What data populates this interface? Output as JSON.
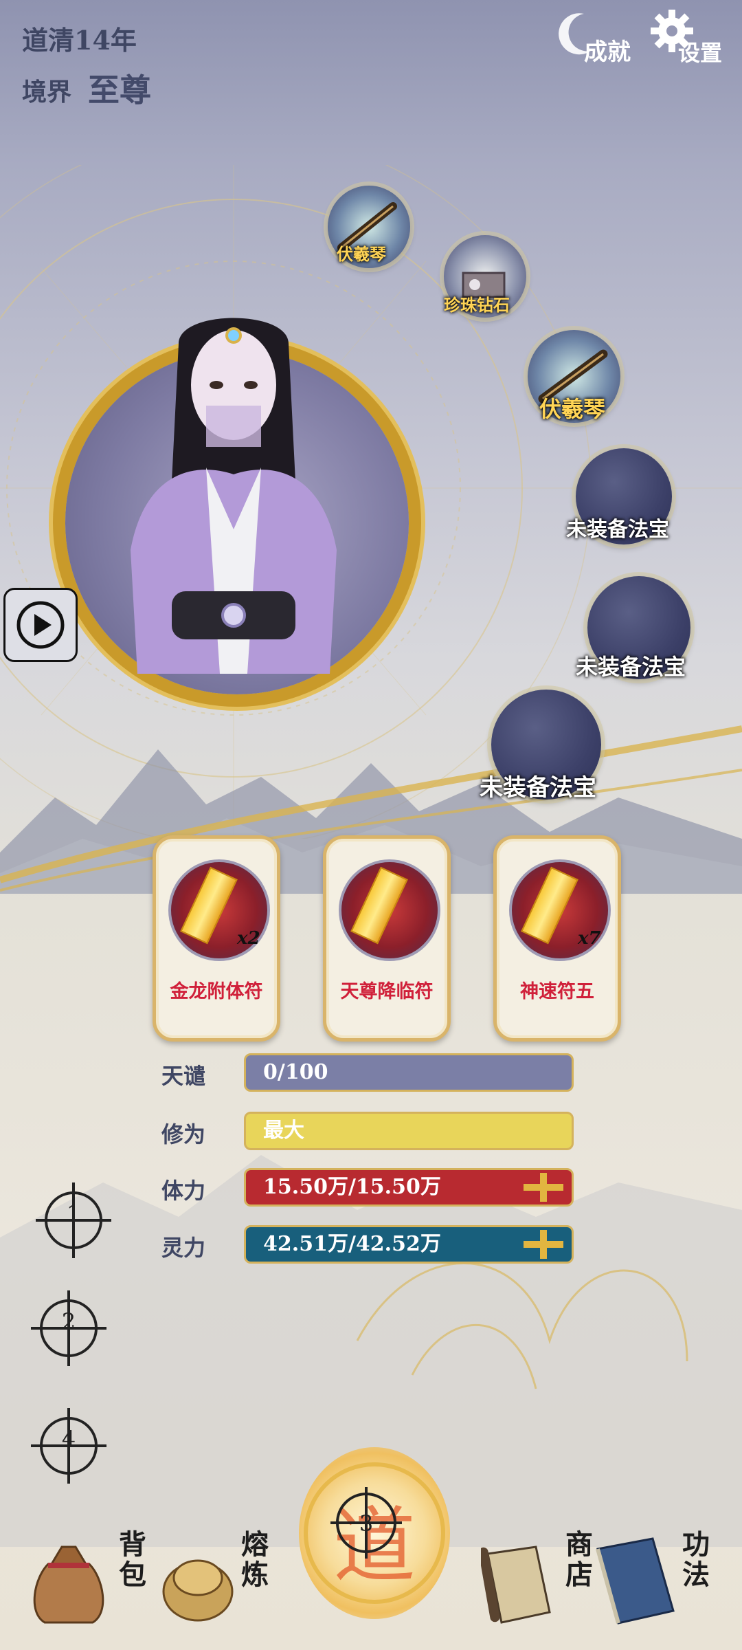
{
  "header": {
    "dao_label": "道清14年",
    "realm_label": "境界",
    "realm_value": "至尊",
    "achievement_label": "成就",
    "settings_label": "设置"
  },
  "equipment_slots": [
    {
      "label": "伏羲琴"
    },
    {
      "label": "珍珠钻石"
    },
    {
      "label": "伏羲琴"
    },
    {
      "label": "未装备法宝"
    },
    {
      "label": "未装备法宝"
    },
    {
      "label": "未装备法宝"
    }
  ],
  "talismans": [
    {
      "name": "金龙附体符",
      "count": "x2"
    },
    {
      "name": "天尊降临符",
      "count": ""
    },
    {
      "name": "神速符五",
      "count": "x7"
    }
  ],
  "stats": {
    "heaven_label": "天谴",
    "heaven_value": "0/100",
    "heaven_fill": 0,
    "body_label": "修为",
    "body_value": "最大",
    "hp_label": "体力",
    "hp_value": "15.50万/15.50万",
    "mp_label": "灵力",
    "mp_value": "42.51万/42.52万"
  },
  "markers": [
    "1",
    "2",
    "4",
    "3"
  ],
  "nav": {
    "bag": "背包",
    "forge": "熔炼",
    "shop": "商店",
    "skills": "功法"
  },
  "colors": {
    "heaven_bar": "#7b7fa6",
    "cultivation_bar": "#e8d55a",
    "hp_bar": "#b82a30",
    "mp_bar": "#185f7c",
    "talisman_name": "#d0203a"
  }
}
